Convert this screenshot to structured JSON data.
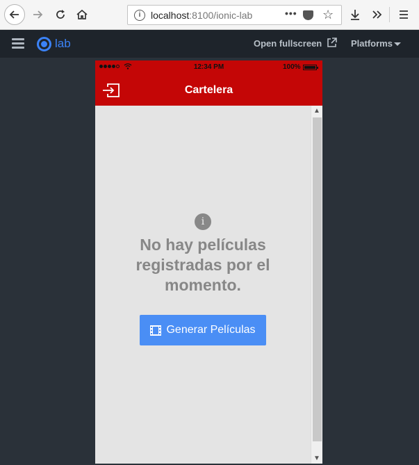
{
  "browser": {
    "url_host": "localhost",
    "url_rest": ":8100/ionic-lab",
    "more_label": "•••"
  },
  "lab": {
    "logo_text": "lab",
    "open_fullscreen": "Open fullscreen",
    "platforms": "Platforms"
  },
  "statusbar": {
    "time": "12:34 PM",
    "battery": "100%"
  },
  "header": {
    "title": "Cartelera"
  },
  "content": {
    "info_glyph": "i",
    "empty_message": "No hay películas registradas por el momento.",
    "generate_button": "Generar Películas"
  },
  "colors": {
    "header": "#c40606",
    "button": "#4a8ef5",
    "lab_accent": "#3b82f6"
  },
  "icons": [
    "back-arrow-icon",
    "forward-arrow-icon",
    "reload-icon",
    "home-icon",
    "info-icon",
    "pocket-icon",
    "star-icon",
    "download-icon",
    "overflow-icon",
    "hamburger-icon",
    "ionic-logo-icon",
    "external-link-icon",
    "caret-down-icon",
    "wifi-icon",
    "battery-icon",
    "logout-icon",
    "film-icon"
  ]
}
